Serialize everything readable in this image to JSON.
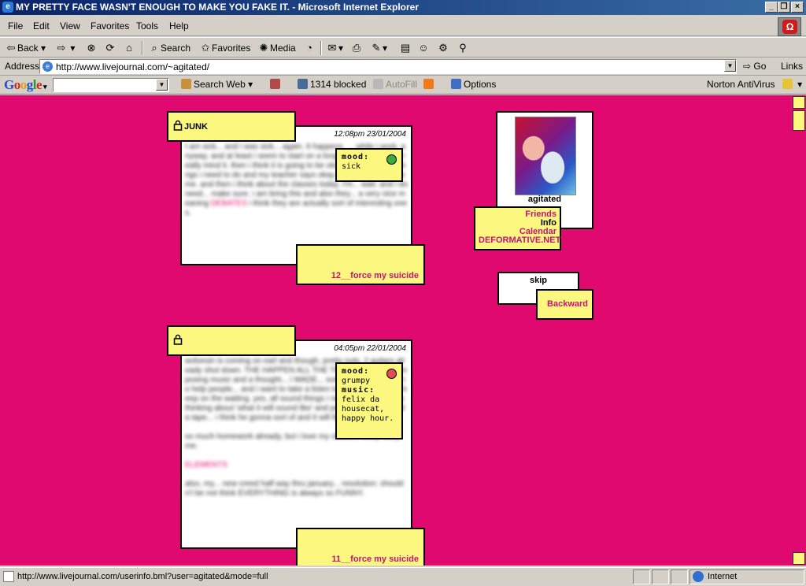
{
  "window": {
    "title": "MY PRETTY FACE WASN'T ENOUGH TO MAKE YOU FAKE IT. - Microsoft Internet Explorer"
  },
  "menu": [
    "File",
    "Edit",
    "View",
    "Favorites",
    "Tools",
    "Help"
  ],
  "toolbar": {
    "back_label": "Back",
    "search_label": "Search",
    "favorites_label": "Favorites",
    "media_label": "Media"
  },
  "address": {
    "label": "Address",
    "url": "http://www.livejournal.com/~agitated/",
    "go_label": "Go",
    "links_label": "Links"
  },
  "google_toolbar": {
    "logo": "Google",
    "search_web_label": "Search Web",
    "blocked_label": "1314 blocked",
    "autofill_label": "AutoFill",
    "options_label": "Options",
    "norton_label": "Norton AntiVirus"
  },
  "entries": [
    {
      "subject": "JUNK",
      "date": "12:08pm 23/01/2004",
      "body": "I am sick... and i was sick... again. It happens. ... while i work. anyway. and at least i seem to start on a long break, so i do not really mind it. then i think it is going to be okay. i have a list of things i need to do and my teacher says okay. the teacher talks to me. and then i think about the classes today. I'm... wait. and i do need... make sure. i am bring this and also they... a very nice meaning",
      "body_link": "DEBATES",
      "body_tail": "i think they are actually sort of interesting ones.",
      "mood_label": "mood:",
      "mood_value": "sick",
      "link": "12__force my suicide"
    },
    {
      "subject": "",
      "date": "04:05pm 22/01/2004",
      "body": "wolvesin is coming on earl and though, pretty nuts, 2 guitars already shut down. THE HAPPEN ALL THE TIME!! Also, I am composing music and a thought... I MADE... something about love to help people... and i want to take a listen to the ones and so i keep on the waiting. yes, all sound things i need... anywho i was thinking about 'what it will sound like' and people... I CAN'T find a tape... i think he gonna sort of and it will feel very good.",
      "body_tail": "so much homework already, but i love my classes. lucky lucky me.",
      "body_link": "ELEMENTS",
      "body_end": "also, my... new creed half way thru january... resolution: shouldn't be not think EVERYTHING is always so FUNNY.",
      "mood_label": "mood:",
      "mood_value": "grumpy",
      "music_label": "music:",
      "music_value": "felix da housecat, happy hour.",
      "link": "11__force my suicide"
    }
  ],
  "sidebar": {
    "username": "agitated",
    "links": [
      "Friends",
      "Info",
      "Calendar",
      "DEFORMATIVE.NET"
    ],
    "active_link": "Info",
    "skip_label": "skip",
    "backward_label": "Backward"
  },
  "status": {
    "text": "http://www.livejournal.com/userinfo.bml?user=agitated&mode=full",
    "zone": "Internet"
  },
  "colors": {
    "page_bg": "#e0096f",
    "box_yellow": "#fbf77f",
    "link_pink": "#c4127a"
  }
}
